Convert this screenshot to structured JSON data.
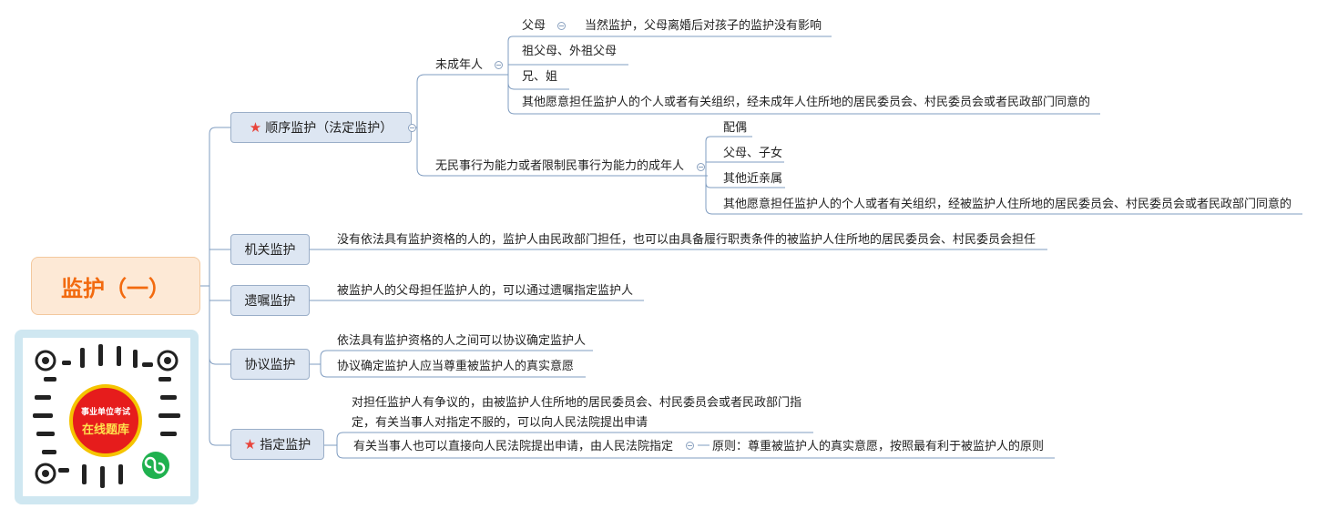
{
  "root": {
    "title": "监护（一）"
  },
  "branches": [
    {
      "label": "顺序监护（法定监护）",
      "starred": true,
      "children": [
        {
          "label": "未成年人",
          "children": [
            {
              "label": "父母",
              "note": "当然监护，父母离婚后对孩子的监护没有影响"
            },
            {
              "label": "祖父母、外祖父母"
            },
            {
              "label": "兄、姐"
            },
            {
              "label": "其他愿意担任监护人的个人或者有关组织，经未成年人住所地的居民委员会、村民委员会或者民政部门同意的"
            }
          ]
        },
        {
          "label": "无民事行为能力或者限制民事行为能力的成年人",
          "children": [
            {
              "label": "配偶"
            },
            {
              "label": "父母、子女"
            },
            {
              "label": "其他近亲属"
            },
            {
              "label": "其他愿意担任监护人的个人或者有关组织，经被监护人住所地的居民委员会、村民委员会或者民政部门同意的"
            }
          ]
        }
      ]
    },
    {
      "label": "机关监护",
      "starred": false,
      "children": [
        {
          "label": "没有依法具有监护资格的人的，监护人由民政部门担任，也可以由具备履行职责条件的被监护人住所地的居民委员会、村民委员会担任"
        }
      ]
    },
    {
      "label": "遗嘱监护",
      "starred": false,
      "children": [
        {
          "label": "被监护人的父母担任监护人的，可以通过遗嘱指定监护人"
        }
      ]
    },
    {
      "label": "协议监护",
      "starred": false,
      "children": [
        {
          "label": "依法具有监护资格的人之间可以协议确定监护人"
        },
        {
          "label": "协议确定监护人应当尊重被监护人的真实意愿"
        }
      ]
    },
    {
      "label": "指定监护",
      "starred": true,
      "children": [
        {
          "label": "对担任监护人有争议的，由被监护人住所地的居民委员会、村民委员会或者民政部门指定，有关当事人对指定不服的，可以向人民法院提出申请"
        },
        {
          "label": "有关当事人也可以直接向人民法院提出申请，由人民法院指定",
          "note": "原则：尊重被监护人的真实意愿，按照最有利于被监护人的原则"
        }
      ]
    }
  ],
  "qr": {
    "line1": "事业单位考试",
    "line2": "在线题库"
  },
  "colors": {
    "root_text": "#f26a0f",
    "root_fill": "#fde9d6",
    "branch_fill": "#dde6f2",
    "line": "#7f9cc0",
    "star": "#e8453c"
  }
}
